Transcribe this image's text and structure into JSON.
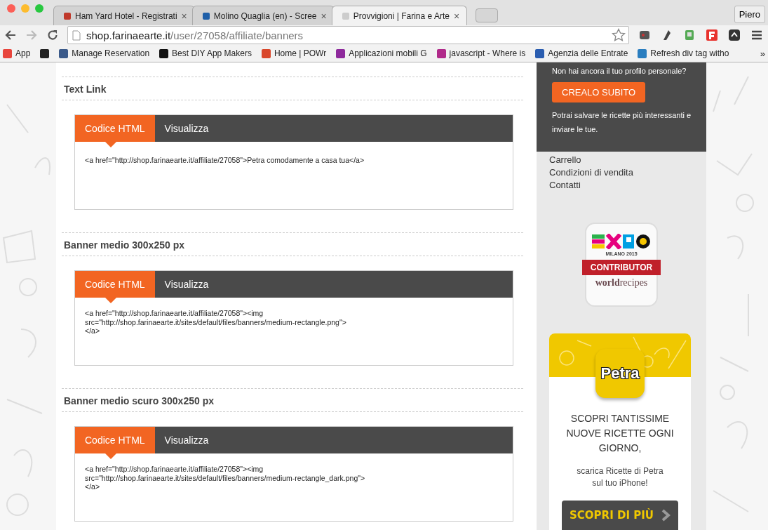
{
  "browser": {
    "tabs": [
      {
        "title": "Ham Yard Hotel - Registrati",
        "color": "#c0392b",
        "selected": false
      },
      {
        "title": "Molino Quaglia (en) - Scree",
        "color": "#1f5fa8",
        "selected": false
      },
      {
        "title": "Provvigioni | Farina e Arte",
        "color": "#cccccc",
        "selected": true
      }
    ],
    "close": "×",
    "profile": "Piero",
    "address": {
      "host": "shop.farinaearte.it",
      "path": "/user/27058/affiliate/banners"
    },
    "bookmarks": [
      {
        "label": "App",
        "color": "#e8453c"
      },
      {
        "color": "#222222"
      },
      {
        "label": "Manage Reservation",
        "color": "#3b5a8a"
      },
      {
        "label": "Best DIY App Makers",
        "color": "#111111"
      },
      {
        "label": "Home | POWr",
        "color": "#d9472b"
      },
      {
        "label": "Applicazioni mobili G",
        "color": "#8e2a9c"
      },
      {
        "label": "javascript - Where is",
        "color": "#b02a8a"
      },
      {
        "label": "Agenzia delle Entrate",
        "color": "#2a5db0"
      },
      {
        "label": "Refresh div tag witho",
        "color": "#2a7ec0"
      }
    ],
    "more": "»"
  },
  "sections": [
    {
      "title": "Text Link",
      "tabs": [
        {
          "label": "Codice HTML",
          "selected": true
        },
        {
          "label": "Visualizza",
          "selected": false
        }
      ],
      "code": "<a href=\"http://shop.farinaearte.it/affiliate/27058\">Petra comodamente a casa tua</a>"
    },
    {
      "title": "Banner medio 300x250 px",
      "tabs": [
        {
          "label": "Codice HTML",
          "selected": true
        },
        {
          "label": "Visualizza",
          "selected": false
        }
      ],
      "code": "<a href=\"http://shop.farinaearte.it/affiliate/27058\"><img\nsrc=\"http://shop.farinaearte.it/sites/default/files/banners/medium-rectangle.png\">\n</a>"
    },
    {
      "title": "Banner medio scuro 300x250 px",
      "tabs": [
        {
          "label": "Codice HTML",
          "selected": true
        },
        {
          "label": "Visualizza",
          "selected": false
        }
      ],
      "code": "<a href=\"http://shop.farinaearte.it/affiliate/27058\"><img\nsrc=\"http://shop.farinaearte.it/sites/default/files/banners/medium-rectangle_dark.png\">\n</a>"
    }
  ],
  "sidebar": {
    "profile_box": {
      "question": "Non hai ancora il tuo profilo personale?",
      "button": "CREALO SUBITO",
      "note": "Potrai salvare le ricette più interessanti e inviare le tue."
    },
    "links": [
      "Carrello",
      "Condizioni di vendita",
      "Contatti"
    ],
    "badge": {
      "milano": "MILANO 2015",
      "ribbon": "CONTRIBUTOR",
      "brand_bold": "world",
      "brand": "recipes"
    },
    "ad": {
      "app": "Petra",
      "headline": "SCOPRI TANTISSIME NUOVE RICETTE OGNI GIORNO,",
      "text": "scarica Ricette di Petra sul tuo iPhone!",
      "button": "SCOPRI DI PIÙ"
    }
  }
}
